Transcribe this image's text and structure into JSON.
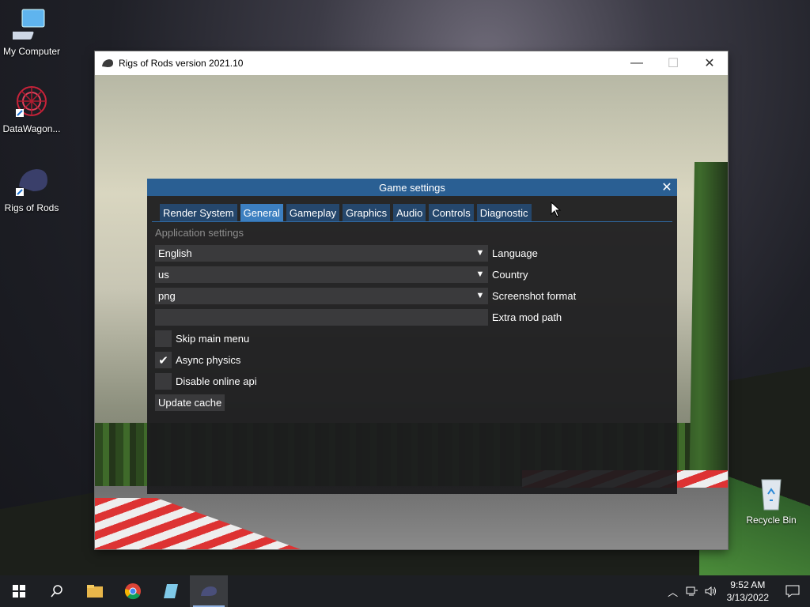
{
  "desktop": {
    "icons": [
      {
        "label": "My Computer",
        "icon": "computer-icon"
      },
      {
        "label": "DataWagon...",
        "icon": "datawagon-icon"
      },
      {
        "label": "Rigs of Rods",
        "icon": "rigs-of-rods-icon"
      },
      {
        "label": "Recycle Bin",
        "icon": "recycle-bin-icon"
      }
    ]
  },
  "window": {
    "title": "Rigs of Rods version 2021.10",
    "minimize": "—",
    "maximize": "☐",
    "close": "✕"
  },
  "dialog": {
    "title": "Game settings",
    "close": "✕",
    "tabs": [
      "Render System",
      "General",
      "Gameplay",
      "Graphics",
      "Audio",
      "Controls",
      "Diagnostic"
    ],
    "active_tab": "General",
    "section": "Application settings",
    "combos": [
      {
        "value": "English",
        "label": "Language"
      },
      {
        "value": "us",
        "label": "Country"
      },
      {
        "value": "png",
        "label": "Screenshot format"
      }
    ],
    "text_field": {
      "value": "",
      "label": "Extra mod path"
    },
    "checkboxes": [
      {
        "label": "Skip main menu",
        "checked": false
      },
      {
        "label": "Async physics",
        "checked": true
      },
      {
        "label": "Disable online api",
        "checked": false
      }
    ],
    "button": "Update cache"
  },
  "taskbar": {
    "clock_time": "9:52 AM",
    "clock_date": "3/13/2022",
    "apps": [
      "start-icon",
      "search-icon",
      "file-explorer-icon",
      "chrome-icon",
      "notepad-icon",
      "rigs-of-rods-icon"
    ]
  },
  "colors": {
    "dialog_title_bg": "#2a5f93",
    "tab_bg": "#25476c",
    "tab_active_bg": "#3c7fc0",
    "taskbar_bg": "#1d1f23"
  }
}
